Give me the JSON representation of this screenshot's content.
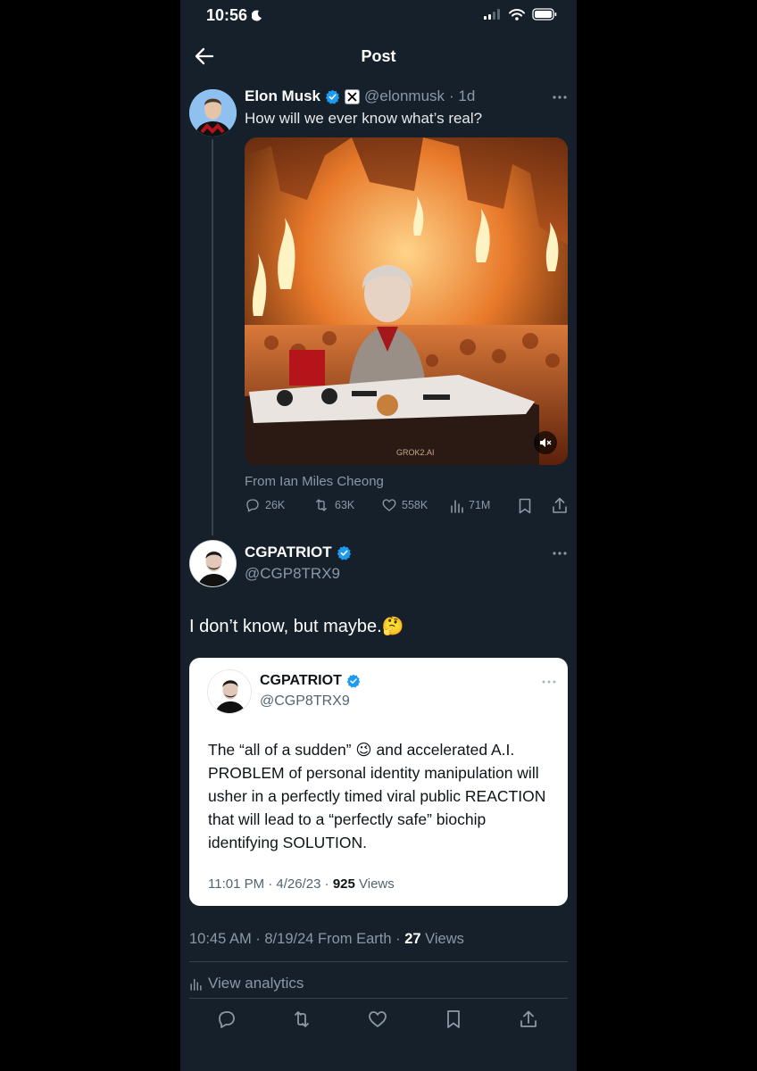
{
  "status_bar": {
    "time": "10:56"
  },
  "nav": {
    "title": "Post"
  },
  "original_post": {
    "display_name": "Elon Musk",
    "handle": "@elonmusk",
    "age": "· 1d",
    "text": "How will we ever know what’s real?",
    "media_watermark": "GROK2.AI",
    "attribution": "From Ian Miles Cheong",
    "stats": {
      "replies": "26K",
      "reposts": "63K",
      "likes": "558K",
      "views": "71M"
    }
  },
  "reply_post": {
    "display_name": "CGPATRIOT",
    "handle": "@CGP8TRX9",
    "text": "I don’t know, but maybe.",
    "emoji": "🤔",
    "quoted": {
      "display_name": "CGPATRIOT",
      "handle": "@CGP8TRX9",
      "text_before_emoji": "The “all of a sudden”",
      "emoji": "😉",
      "text_after_emoji": "and accelerated A.I. PROBLEM of personal identity manipulation will usher in a perfectly timed viral public REACTION that will lead to a “perfectly safe” biochip identifying SOLUTION.",
      "timestamp": "11:01 PM · 4/26/23 ·",
      "views_count": "925",
      "views_label": "Views"
    },
    "timestamp": "10:45 AM · 8/19/24 From Earth ·",
    "views_count": "27",
    "views_label": "Views",
    "analytics_label": "View analytics"
  },
  "colors": {
    "background": "#15202b",
    "verified": "#1d9bf0",
    "muted": "#8b98a5"
  }
}
